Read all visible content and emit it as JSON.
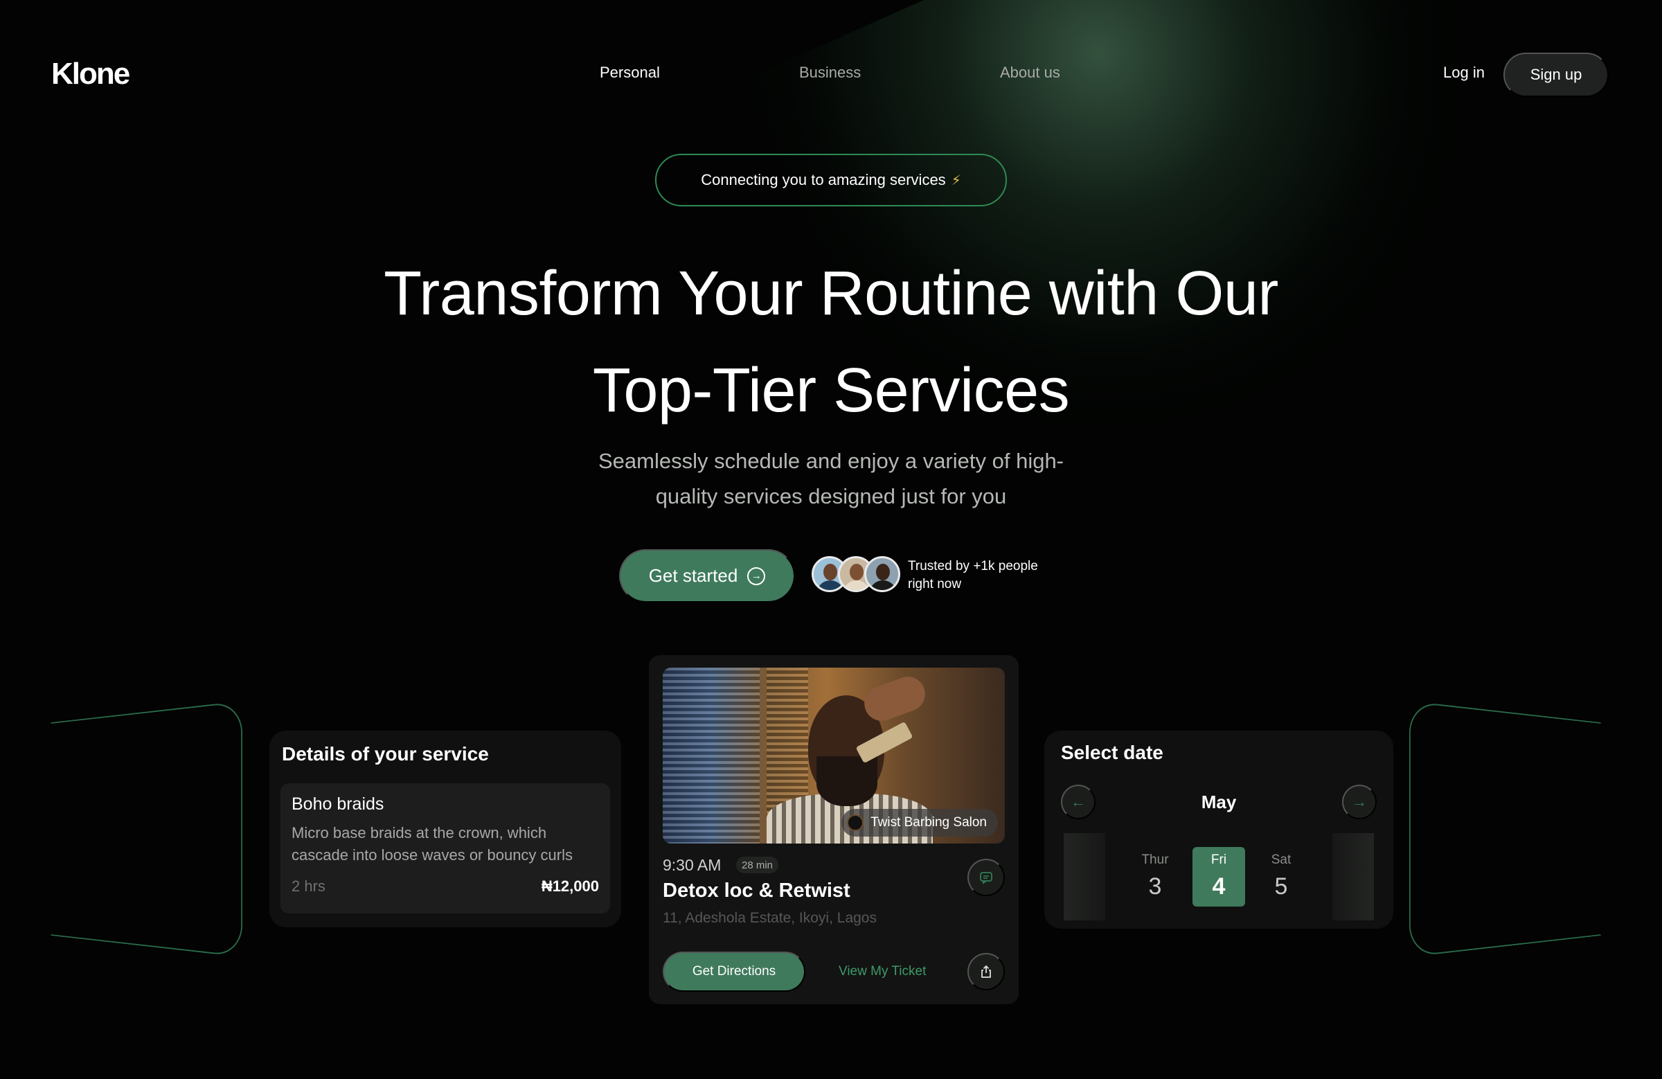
{
  "brand": {
    "logo": "Klone"
  },
  "nav": {
    "links": [
      "Personal",
      "Business",
      "About us"
    ],
    "login": "Log in",
    "signup": "Sign up"
  },
  "hero": {
    "pill": "Connecting you to amazing services",
    "pill_icon": "lightning-icon",
    "title_line1": "Transform Your Routine with Our",
    "title_line2": "Top-Tier Services",
    "subtitle_line1": "Seamlessly schedule and enjoy a variety of high-",
    "subtitle_line2": "quality services designed just for you",
    "cta": "Get started",
    "trust_line1": "Trusted by +1k people",
    "trust_line2": "right now"
  },
  "service_card": {
    "title": "Details of your service",
    "name": "Boho braids",
    "description": "Micro base braids at the crown, which cascade into loose waves or bouncy curls",
    "duration": "2 hrs",
    "price": "₦12,000"
  },
  "booking_card": {
    "salon": "Twist Barbing Salon",
    "time": "9:30 AM",
    "duration": "28 min",
    "service": "Detox loc & Retwist",
    "address": "11, Adeshola Estate, Ikoyi, Lagos",
    "directions": "Get Directions",
    "ticket": "View My Ticket"
  },
  "date_card": {
    "title": "Select date",
    "month": "May",
    "days": [
      {
        "name": "Thur",
        "date": "3"
      },
      {
        "name": "Fri",
        "date": "4"
      },
      {
        "name": "Sat",
        "date": "5"
      }
    ],
    "selected_index": 1
  },
  "colors": {
    "background": "#020302",
    "accent": "#3f7a5c",
    "border_accent": "#2e8a54",
    "bolt": "#e6c14a"
  }
}
